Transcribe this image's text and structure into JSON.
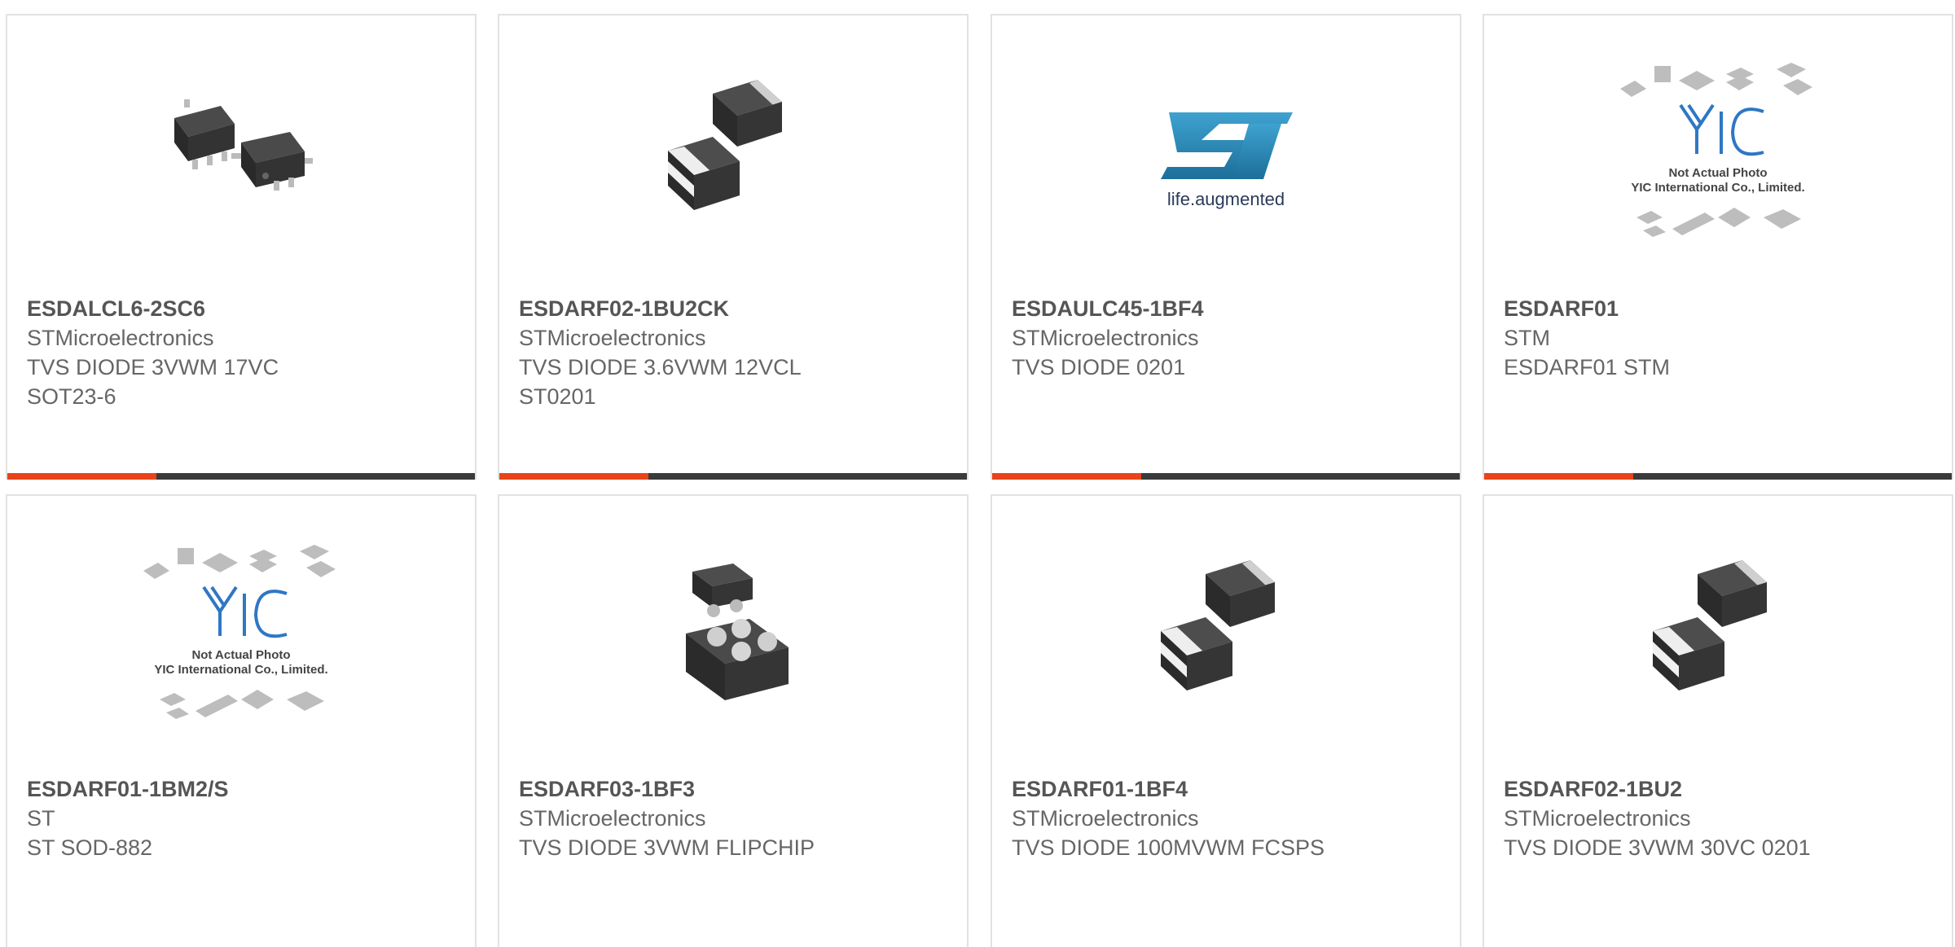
{
  "colors": {
    "accent": "#e8431a",
    "bar": "#3a3a3a",
    "border": "#e2e2e2",
    "text": "#666666"
  },
  "products": [
    {
      "part": "ESDALCL6-2SC6",
      "maker": "STMicroelectronics",
      "desc": "TVS DIODE 3VWM 17VC",
      "extra": "SOT23-6",
      "image": "sot23-6-package-icon"
    },
    {
      "part": "ESDARF02-1BU2CK",
      "maker": "STMicroelectronics",
      "desc": "TVS DIODE 3.6VWM 12VCL",
      "extra": "ST0201",
      "image": "st0201-package-icon"
    },
    {
      "part": "ESDAULC45-1BF4",
      "maker": "STMicroelectronics",
      "desc": "TVS DIODE 0201",
      "extra": "",
      "image": "st-logo-icon",
      "logo_text": "life.augmented"
    },
    {
      "part": "ESDARF01",
      "maker": "STM",
      "desc": "ESDARF01 STM",
      "extra": "",
      "image": "yic-placeholder-icon",
      "placeholder_line1": "Not Actual Photo",
      "placeholder_line2": "YIC International Co., Limited."
    },
    {
      "part": "ESDARF01-1BM2/S",
      "maker": "ST",
      "desc": "ST SOD-882",
      "extra": "",
      "image": "yic-placeholder-icon",
      "placeholder_line1": "Not Actual Photo",
      "placeholder_line2": "YIC International Co., Limited."
    },
    {
      "part": "ESDARF03-1BF3",
      "maker": "STMicroelectronics",
      "desc": "TVS DIODE 3VWM FLIPCHIP",
      "extra": "",
      "image": "flipchip-package-icon"
    },
    {
      "part": "ESDARF01-1BF4",
      "maker": "STMicroelectronics",
      "desc": "TVS DIODE 100MVWM FCSPS",
      "extra": "",
      "image": "st0201-package-icon"
    },
    {
      "part": "ESDARF02-1BU2",
      "maker": "STMicroelectronics",
      "desc": "TVS DIODE 3VWM 30VC 0201",
      "extra": "",
      "image": "st0201-package-icon"
    }
  ]
}
